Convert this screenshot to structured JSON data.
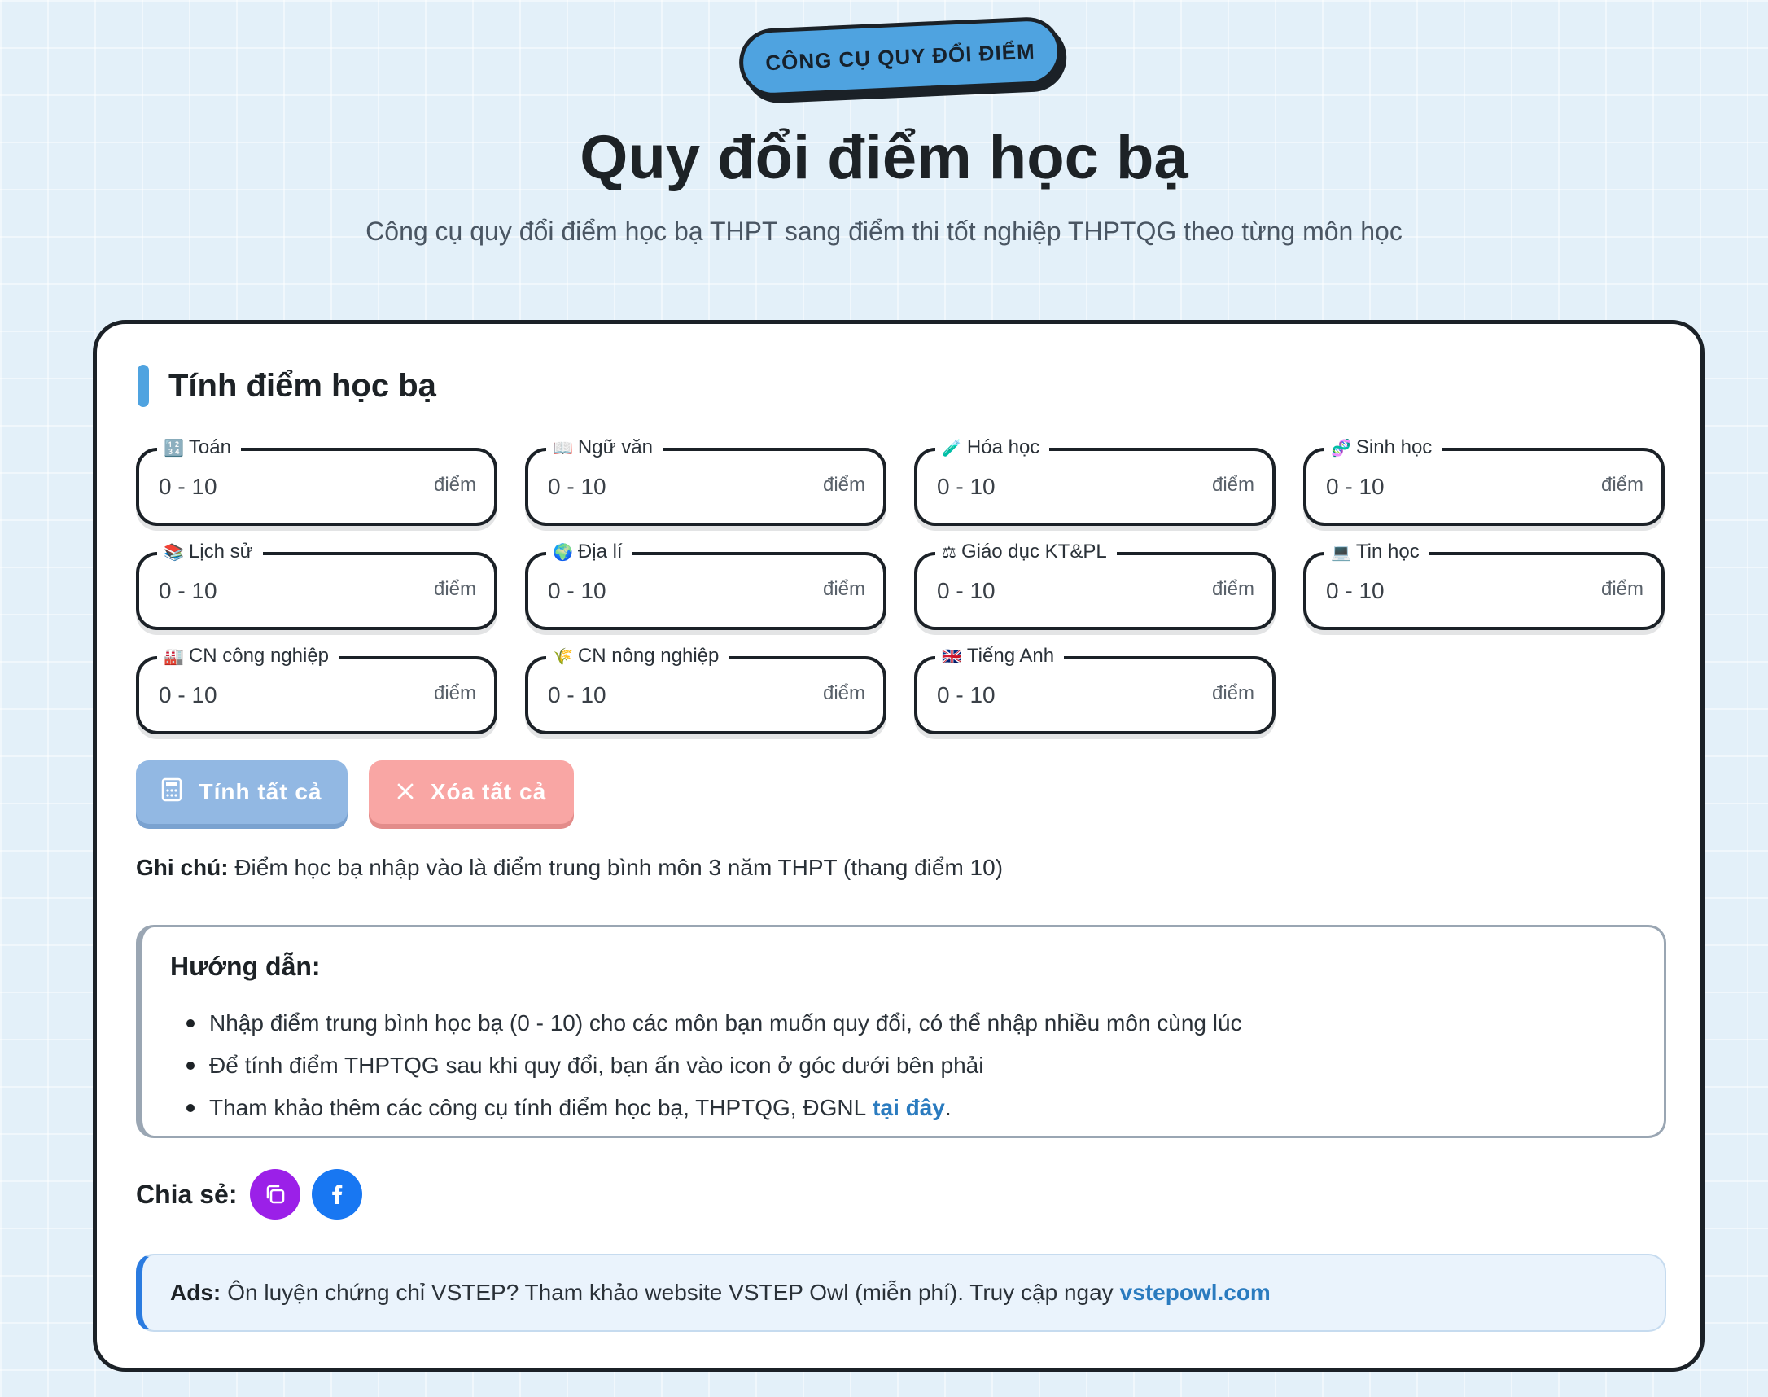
{
  "hero": {
    "badge": "CÔNG CỤ QUY ĐỔI ĐIỂM",
    "title": "Quy đổi điểm học bạ",
    "subtitle": "Công cụ quy đổi điểm học bạ THPT sang điểm thi tốt nghiệp THPTQG theo từng môn học"
  },
  "card": {
    "heading": "Tính điểm học bạ",
    "subjects": [
      {
        "label": "Toán",
        "icon": "🔢",
        "placeholder": "0 - 10",
        "unit": "điểm"
      },
      {
        "label": "Ngữ văn",
        "icon": "📖",
        "placeholder": "0 - 10",
        "unit": "điểm"
      },
      {
        "label": "Hóa học",
        "icon": "🧪",
        "placeholder": "0 - 10",
        "unit": "điểm"
      },
      {
        "label": "Sinh học",
        "icon": "🧬",
        "placeholder": "0 - 10",
        "unit": "điểm"
      },
      {
        "label": "Lịch sử",
        "icon": "📚",
        "placeholder": "0 - 10",
        "unit": "điểm"
      },
      {
        "label": "Địa lí",
        "icon": "🌍",
        "placeholder": "0 - 10",
        "unit": "điểm"
      },
      {
        "label": "Giáo dục KT&PL",
        "icon": "⚖",
        "placeholder": "0 - 10",
        "unit": "điểm"
      },
      {
        "label": "Tin học",
        "icon": "💻",
        "placeholder": "0 - 10",
        "unit": "điểm"
      },
      {
        "label": "CN công nghiệp",
        "icon": "🏭",
        "placeholder": "0 - 10",
        "unit": "điểm"
      },
      {
        "label": "CN nông nghiệp",
        "icon": "🌾",
        "placeholder": "0 - 10",
        "unit": "điểm"
      },
      {
        "label": "Tiếng Anh",
        "icon": "🇬🇧",
        "placeholder": "0 - 10",
        "unit": "điểm"
      }
    ],
    "buttons": {
      "calc_label": "Tính tất cả",
      "calc_icon": "calculator-icon",
      "clear_label": "Xóa tất cả",
      "clear_icon": "close-icon"
    },
    "note": {
      "label": "Ghi chú:",
      "text": "Điểm học bạ nhập vào là điểm trung bình môn 3 năm THPT (thang điểm 10)"
    },
    "guide": {
      "heading": "Hướng dẫn:",
      "items": [
        "Nhập điểm trung bình học bạ (0 - 10) cho các môn bạn muốn quy đổi, có thể nhập nhiều môn cùng lúc",
        "Để tính điểm THPTQG sau khi quy đổi, bạn ấn vào icon ở góc dưới bên phải",
        "Tham khảo thêm các công cụ tính điểm học bạ, THPTQG, ĐGNL"
      ],
      "link_text": "tại đây",
      "link_suffix": "."
    },
    "share": {
      "label": "Chia sẻ:",
      "copy_color": "#9b20e8",
      "facebook_color": "#1877f2"
    },
    "ads": {
      "label": "Ads:",
      "text": "Ôn luyện chứng chỉ VSTEP? Tham khảo website VSTEP Owl (miễn phí). Truy cập ngay",
      "link_text": "vstepowl.com"
    }
  },
  "colors": {
    "accent": "#4fa3e0",
    "border": "#1b2127",
    "link": "#2a7bbf"
  }
}
